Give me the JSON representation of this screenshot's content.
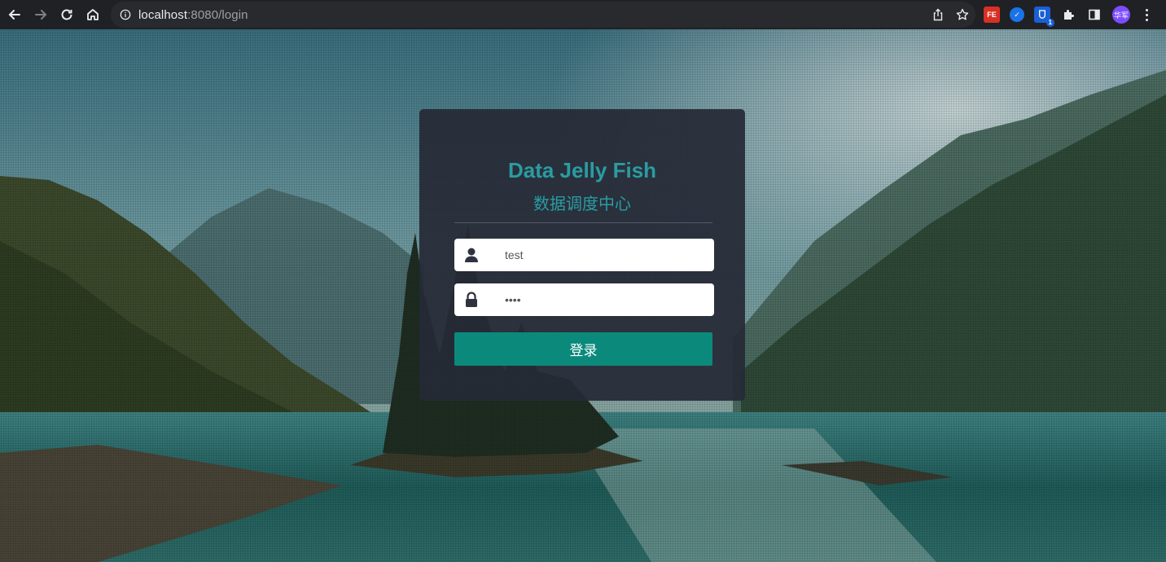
{
  "browser": {
    "url_host": "localhost",
    "url_rest": ":8080/login",
    "extensions": [
      {
        "name": "fe-helper-extension",
        "label": "FE"
      },
      {
        "name": "check-extension",
        "label": "✓"
      },
      {
        "name": "shield-extension",
        "label": "",
        "badge": "1"
      }
    ],
    "profile_label": "华军"
  },
  "login": {
    "title": "Data Jelly Fish",
    "subtitle": "数据调度中心",
    "username_value": "test",
    "password_value": "••••",
    "submit_label": "登录"
  },
  "colors": {
    "accent": "#2a9ca2",
    "button": "#0b8a7c",
    "card": "#262a36"
  }
}
